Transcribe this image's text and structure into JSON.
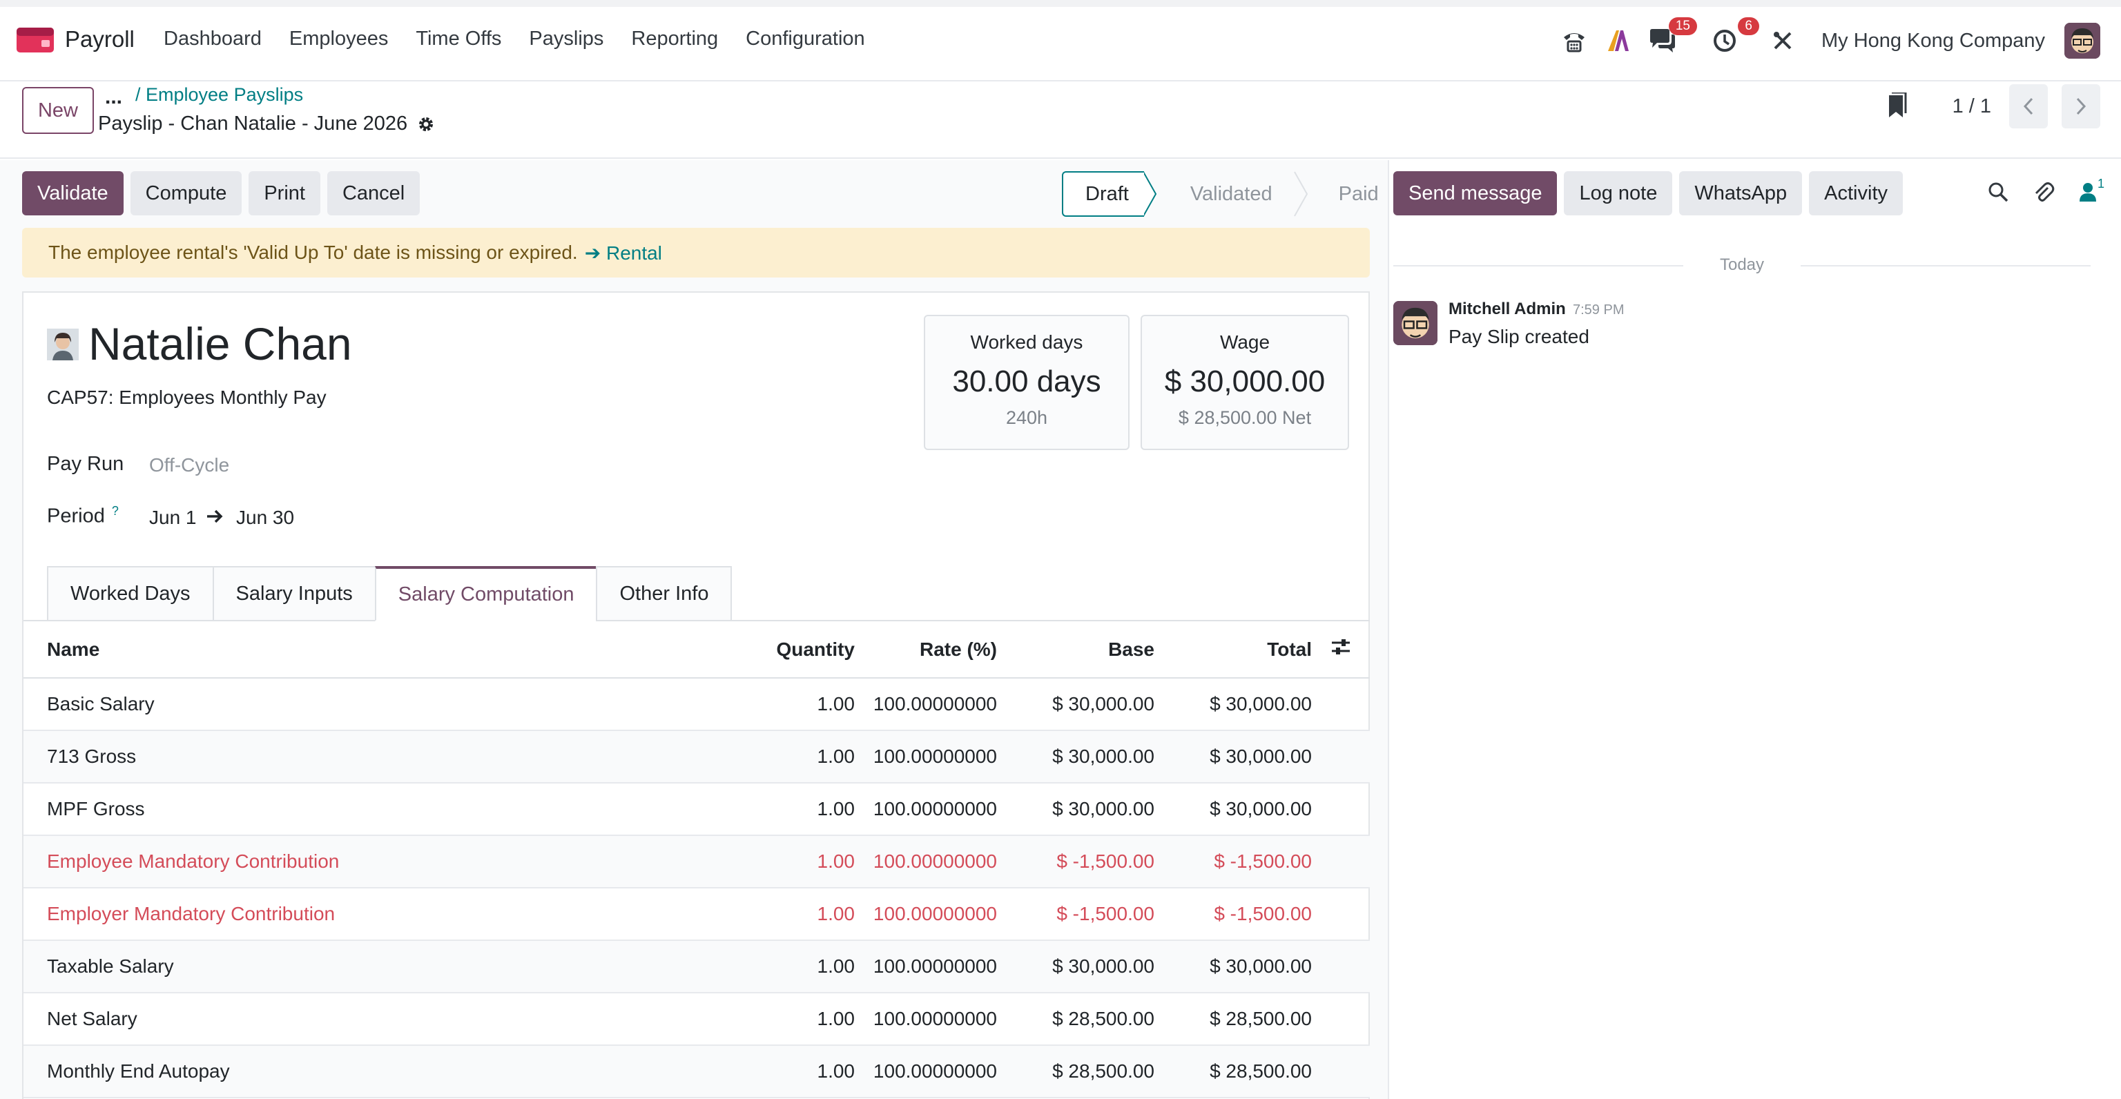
{
  "app": {
    "name": "Payroll"
  },
  "menu": [
    "Dashboard",
    "Employees",
    "Time Offs",
    "Payslips",
    "Reporting",
    "Configuration"
  ],
  "systray": {
    "chat_badge": "15",
    "activity_badge": "6",
    "company": "My Hong Kong Company"
  },
  "control": {
    "new_label": "New",
    "breadcrumb_dots": "...",
    "breadcrumb_parent": "/ Employee Payslips",
    "record_title": "Payslip - Chan Natalie - June 2026",
    "pager": "1 / 1"
  },
  "actions": [
    "Validate",
    "Compute",
    "Print",
    "Cancel"
  ],
  "status": {
    "stages": [
      "Draft",
      "Validated",
      "Paid"
    ],
    "current": "Draft"
  },
  "alert": {
    "text": "The employee rental's 'Valid Up To' date is missing or expired.",
    "link": "Rental"
  },
  "employee": {
    "name": "Natalie Chan",
    "structure": "CAP57: Employees Monthly Pay",
    "pay_run_label": "Pay Run",
    "pay_run_value": "Off-Cycle",
    "period_label": "Period",
    "period_help": "?",
    "period_from": "Jun 1",
    "period_to": "Jun 30"
  },
  "stats": {
    "worked": {
      "title": "Worked days",
      "value": "30.00 days",
      "sub": "240h"
    },
    "wage": {
      "title": "Wage",
      "value": "$ 30,000.00",
      "sub": "$ 28,500.00 Net"
    }
  },
  "tabs": [
    "Worked Days",
    "Salary Inputs",
    "Salary Computation",
    "Other Info"
  ],
  "active_tab": "Salary Computation",
  "table": {
    "headers": [
      "Name",
      "Quantity",
      "Rate (%)",
      "Base",
      "Total"
    ],
    "rows": [
      {
        "name": "Basic Salary",
        "qty": "1.00",
        "rate": "100.00000000",
        "base": "$ 30,000.00",
        "total": "$ 30,000.00"
      },
      {
        "name": "713 Gross",
        "qty": "1.00",
        "rate": "100.00000000",
        "base": "$ 30,000.00",
        "total": "$ 30,000.00"
      },
      {
        "name": "MPF Gross",
        "qty": "1.00",
        "rate": "100.00000000",
        "base": "$ 30,000.00",
        "total": "$ 30,000.00"
      },
      {
        "name": "Employee Mandatory Contribution",
        "qty": "1.00",
        "rate": "100.00000000",
        "base": "$ -1,500.00",
        "total": "$ -1,500.00"
      },
      {
        "name": "Employer Mandatory Contribution",
        "qty": "1.00",
        "rate": "100.00000000",
        "base": "$ -1,500.00",
        "total": "$ -1,500.00"
      },
      {
        "name": "Taxable Salary",
        "qty": "1.00",
        "rate": "100.00000000",
        "base": "$ 30,000.00",
        "total": "$ 30,000.00"
      },
      {
        "name": "Net Salary",
        "qty": "1.00",
        "rate": "100.00000000",
        "base": "$ 28,500.00",
        "total": "$ 28,500.00"
      },
      {
        "name": "Monthly End Autopay",
        "qty": "1.00",
        "rate": "100.00000000",
        "base": "$ 28,500.00",
        "total": "$ 28,500.00"
      }
    ]
  },
  "chatter": {
    "buttons": [
      "Send message",
      "Log note",
      "WhatsApp",
      "Activity"
    ],
    "followers_count": "1",
    "date_separator": "Today",
    "message": {
      "author": "Mitchell Admin",
      "time": "7:59 PM",
      "body": "Pay Slip created"
    }
  },
  "colors": {
    "brand": "#714b67",
    "link": "#017e84",
    "danger": "#d44c59",
    "alert_bg": "#fcefd0"
  }
}
